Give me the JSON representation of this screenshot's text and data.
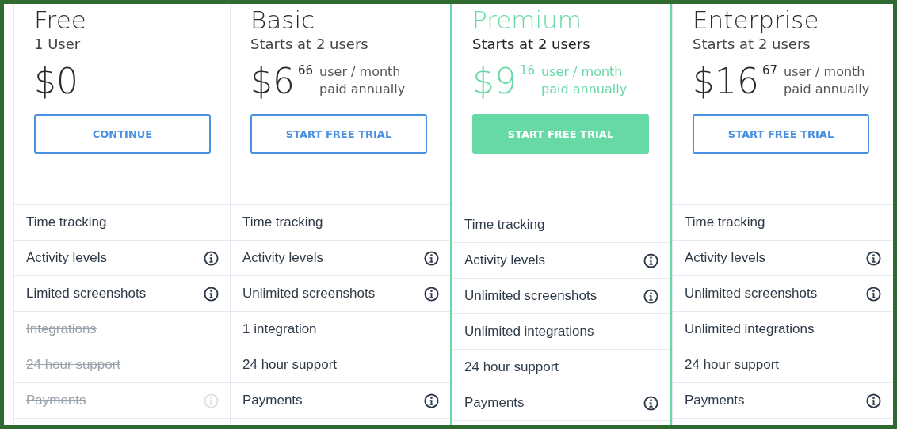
{
  "plans": [
    {
      "name": "Free",
      "subtitle": "1 User",
      "highlighted": false,
      "price": {
        "amount": "$0"
      },
      "button": "CONTINUE",
      "features": [
        {
          "label": "Time tracking",
          "included": true,
          "info": false
        },
        {
          "label": "Activity levels",
          "included": true,
          "info": true
        },
        {
          "label": "Limited screenshots",
          "included": true,
          "info": true
        },
        {
          "label": "Integrations",
          "included": false,
          "info": false
        },
        {
          "label": "24 hour support",
          "included": false,
          "info": false
        },
        {
          "label": "Payments",
          "included": false,
          "info": true
        }
      ]
    },
    {
      "name": "Basic",
      "subtitle": "Starts at 2 users",
      "highlighted": false,
      "price": {
        "amount": "$6",
        "cents": "66",
        "unit": "user / month",
        "billing": "paid annually"
      },
      "button": "START FREE TRIAL",
      "features": [
        {
          "label": "Time tracking",
          "included": true,
          "info": false
        },
        {
          "label": "Activity levels",
          "included": true,
          "info": true
        },
        {
          "label": "Unlimited screenshots",
          "included": true,
          "info": true
        },
        {
          "label": "1 integration",
          "included": true,
          "info": false
        },
        {
          "label": "24 hour support",
          "included": true,
          "info": false
        },
        {
          "label": "Payments",
          "included": true,
          "info": true
        }
      ]
    },
    {
      "name": "Premium",
      "subtitle": "Starts at 2 users",
      "highlighted": true,
      "price": {
        "amount": "$9",
        "cents": "16",
        "unit": "user / month",
        "billing": "paid annually"
      },
      "button": "START FREE TRIAL",
      "features": [
        {
          "label": "Time tracking",
          "included": true,
          "info": false
        },
        {
          "label": "Activity levels",
          "included": true,
          "info": true
        },
        {
          "label": "Unlimited screenshots",
          "included": true,
          "info": true
        },
        {
          "label": "Unlimited integrations",
          "included": true,
          "info": false
        },
        {
          "label": "24 hour support",
          "included": true,
          "info": false
        },
        {
          "label": "Payments",
          "included": true,
          "info": true
        }
      ]
    },
    {
      "name": "Enterprise",
      "subtitle": "Starts at 2 users",
      "highlighted": false,
      "price": {
        "amount": "$16",
        "cents": "67",
        "unit": "user / month",
        "billing": "paid annually"
      },
      "button": "START FREE TRIAL",
      "features": [
        {
          "label": "Time tracking",
          "included": true,
          "info": false
        },
        {
          "label": "Activity levels",
          "included": true,
          "info": true
        },
        {
          "label": "Unlimited screenshots",
          "included": true,
          "info": true
        },
        {
          "label": "Unlimited integrations",
          "included": true,
          "info": false
        },
        {
          "label": "24 hour support",
          "included": true,
          "info": false
        },
        {
          "label": "Payments",
          "included": true,
          "info": true
        }
      ]
    }
  ]
}
